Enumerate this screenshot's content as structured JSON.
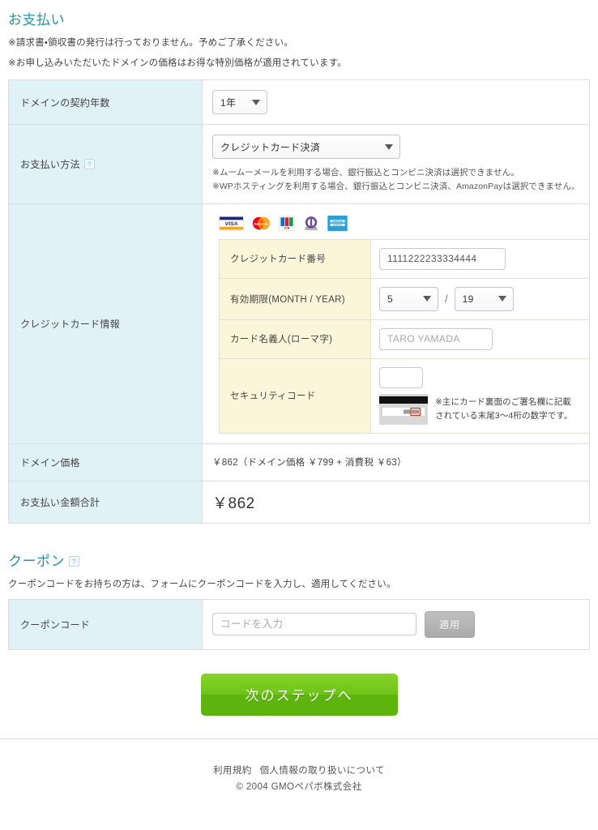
{
  "payment": {
    "title": "お支払い",
    "notes": [
      "※請求書・領収書の発行は行っておりません。予めご了承ください。",
      "※お申し込みいただいたドメインの価格はお得な特別価格が適用されています。"
    ],
    "rows": {
      "term": {
        "label": "ドメインの契約年数",
        "select_value": "1年"
      },
      "method": {
        "label": "お支払い方法",
        "help_icon": "question-icon",
        "help_glyph": "?",
        "select_value": "クレジットカード決済",
        "sub_notes": [
          "※ムームーメールを利用する場合、銀行振込とコンビニ決済は選択できません。",
          "※WPホスティングを利用する場合、銀行振込とコンビニ決済、AmazonPayは選択できません。"
        ]
      },
      "card": {
        "label": "クレジットカード情報",
        "brands": [
          {
            "icon": "visa-logo",
            "name": "VISA"
          },
          {
            "icon": "mastercard-logo",
            "name": "MasterCard"
          },
          {
            "icon": "jcb-logo",
            "name": "JCB"
          },
          {
            "icon": "diners-club-logo",
            "name": "Diners Club International"
          },
          {
            "icon": "american-express-logo",
            "name": "American Express"
          }
        ],
        "number": {
          "label": "クレジットカード番号",
          "value": "1111222233334444"
        },
        "expiry": {
          "label": "有効期限(MONTH / YEAR)",
          "month": "5",
          "separator": "/",
          "year": "19"
        },
        "holder": {
          "label": "カード名義人(ローマ字)",
          "placeholder": "TARO YAMADA",
          "value": ""
        },
        "security": {
          "label": "セキュリティコード",
          "value": "",
          "card_icon": "card-back-icon",
          "hint_lines": [
            "※主にカード裏面のご署名欄に記載",
            "されている末尾3〜4桁の数字です。"
          ]
        }
      },
      "domain_price": {
        "label": "ドメイン価格",
        "value": "￥862（ドメイン価格 ￥799 + 消費税 ￥63）"
      },
      "total": {
        "label": "お支払い金額合計",
        "value": "￥862"
      }
    }
  },
  "coupon": {
    "title": "クーポン",
    "help_icon": "question-icon",
    "help_glyph": "?",
    "description": "クーポンコードをお持ちの方は、フォームにクーポンコードを入力し、適用してください。",
    "row_label": "クーポンコード",
    "input_placeholder": "コードを入力",
    "input_value": "",
    "apply_label": "適用"
  },
  "submit": {
    "label": "次のステップへ"
  },
  "footer": {
    "links": [
      "利用規約",
      "個人情報の取り扱いについて"
    ],
    "copyright": "© 2004 GMOペパボ株式会社"
  },
  "colors": {
    "heading": "#2196ab",
    "label_cell": "#e1f2f7",
    "cc_label_cell": "#fbf6d9",
    "submit_green": "#5cb40d",
    "apply_gray": "#ababab",
    "border": "#dcdcdc"
  }
}
